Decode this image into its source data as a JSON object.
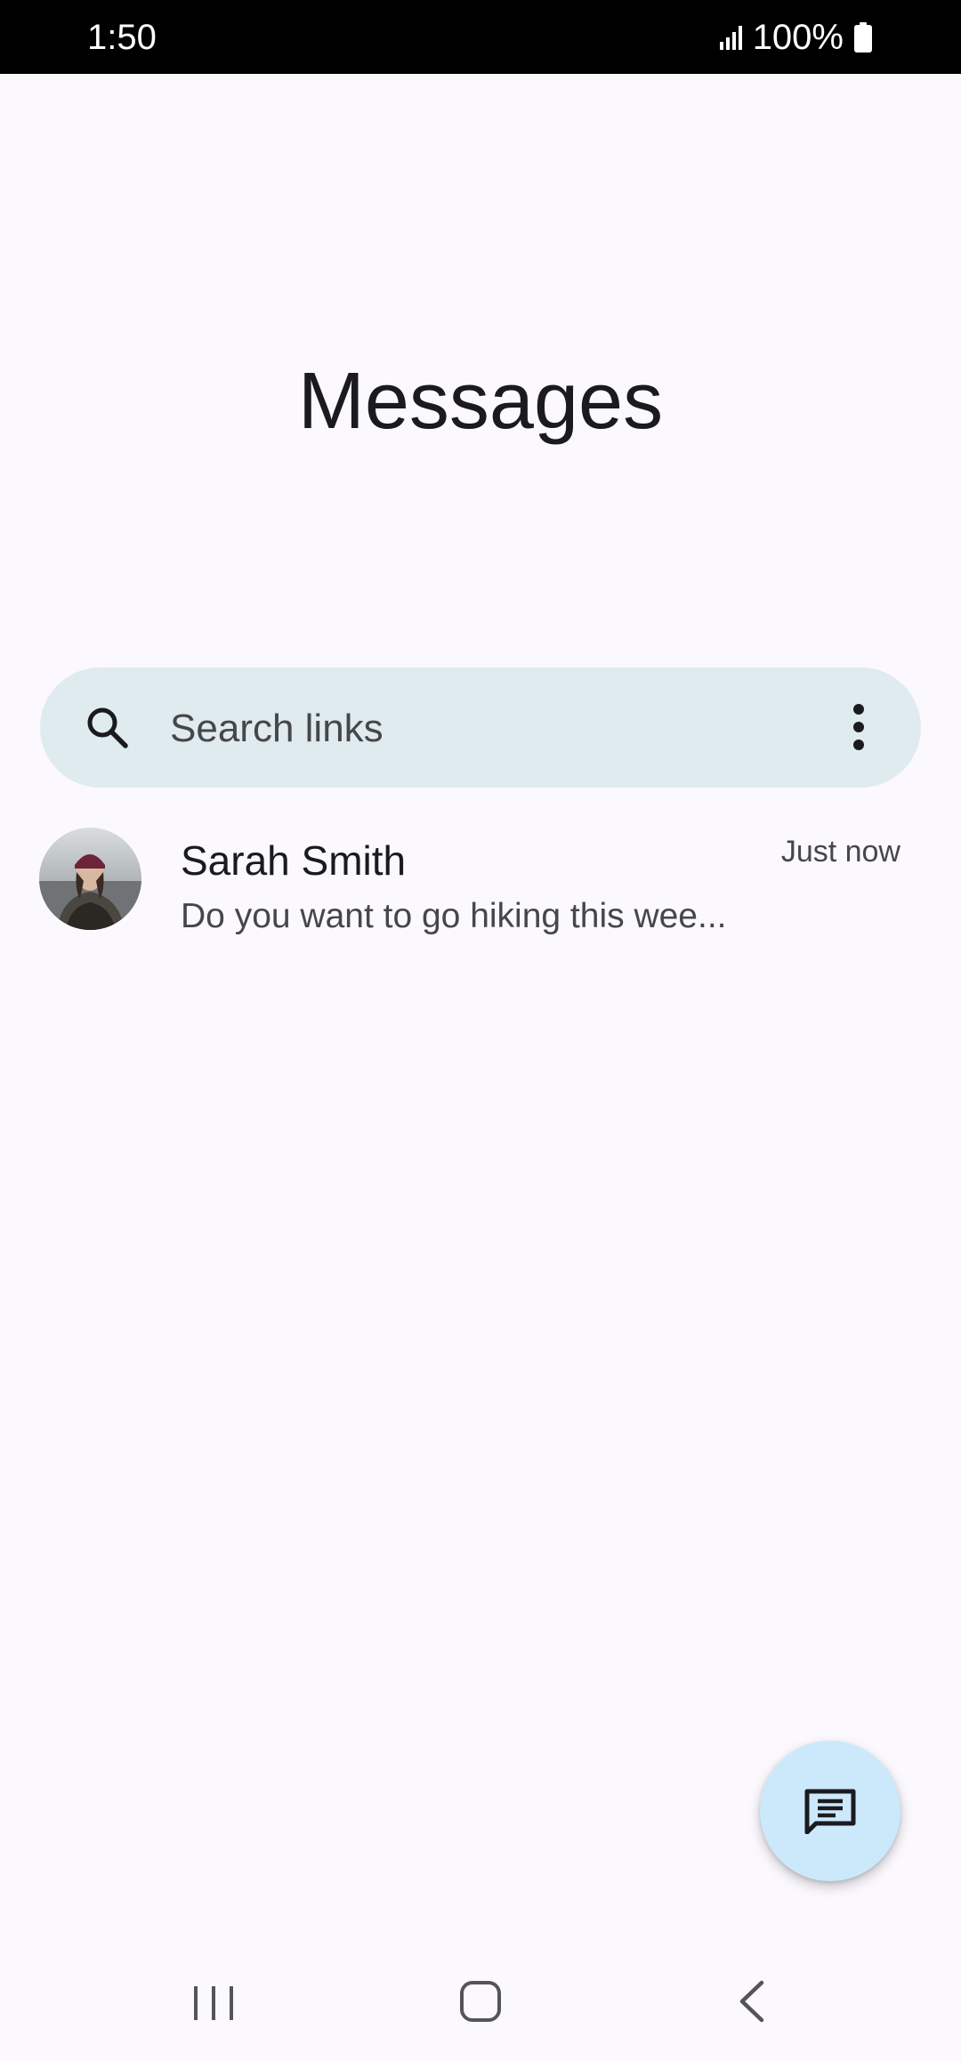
{
  "status_bar": {
    "time": "1:50",
    "battery": "100%",
    "icons": [
      "signal-icon",
      "battery-icon"
    ]
  },
  "header": {
    "title": "Messages"
  },
  "search": {
    "placeholder": "Search links",
    "icons": [
      "search-icon",
      "more-vert-icon"
    ]
  },
  "conversations": [
    {
      "name": "Sarah Smith",
      "time": "Just now",
      "preview": "Do you want to go hiking this wee..."
    }
  ],
  "fab": {
    "icon": "compose-message-icon"
  },
  "nav_bar": {
    "icons": [
      "recents-icon",
      "home-icon",
      "back-icon"
    ]
  },
  "colors": {
    "background": "#fbf9fe",
    "search_bar": "#e0ebf0",
    "fab": "#cce9fb",
    "text_primary": "#1b1b1f",
    "text_secondary": "#45474a"
  }
}
